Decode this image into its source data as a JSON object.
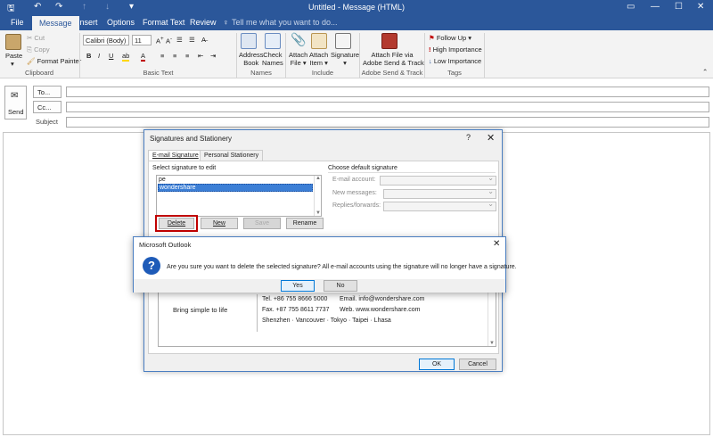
{
  "window": {
    "title": "Untitled - Message (HTML)"
  },
  "tabs": [
    "File",
    "Message",
    "Insert",
    "Options",
    "Format Text",
    "Review"
  ],
  "tell_me": "Tell me what you want to do...",
  "ribbon": {
    "clipboard": {
      "paste": "Paste",
      "cut": "Cut",
      "copy": "Copy",
      "format_painter": "Format Painter",
      "label": "Clipboard"
    },
    "basic_text": {
      "font": "Calibri (Body)",
      "size": "11",
      "label": "Basic Text"
    },
    "names": {
      "address_book": [
        "Address",
        "Book"
      ],
      "check_names": [
        "Check",
        "Names"
      ],
      "label": "Names"
    },
    "include": {
      "attach_file": [
        "Attach",
        "File"
      ],
      "attach_item": [
        "Attach",
        "Item"
      ],
      "signature": "Signature",
      "label": "Include"
    },
    "adobe": {
      "attach": [
        "Attach File via",
        "Adobe Send & Track"
      ],
      "label": "Adobe Send & Track"
    },
    "tags": {
      "follow_up": "Follow Up",
      "high": "High Importance",
      "low": "Low Importance",
      "label": "Tags"
    }
  },
  "compose": {
    "send": "Send",
    "to": "To...",
    "cc": "Cc...",
    "subject": "Subject"
  },
  "signatures_dialog": {
    "title": "Signatures and Stationery",
    "help": "?",
    "tabs": [
      "E-mail Signature",
      "Personal Stationery"
    ],
    "select_label": "Select signature to edit",
    "signatures": [
      "pe",
      "wondershare"
    ],
    "selected": "wondershare",
    "buttons": {
      "delete": "Delete",
      "new": "New",
      "save": "Save",
      "rename": "Rename"
    },
    "defaults_label": "Choose default signature",
    "email_account": "E-mail account:",
    "new_messages": "New messages:",
    "replies": "Replies/forwards:",
    "preview": {
      "tagline": "Bring simple to life",
      "tel": "Tel. +86 755 8666 5000",
      "fax": "Fax. +87 755 8611 7737",
      "email": "Email. info@wondershare.com",
      "web": "Web. www.wondershare.com",
      "cities": "Shenzhen · Vancouver · Tokyo · Taipei · Lhasa"
    },
    "ok": "OK",
    "cancel": "Cancel"
  },
  "confirm_dialog": {
    "title": "Microsoft Outlook",
    "message": "Are you sure you want to delete the selected signature? All e-mail accounts using the signature will no longer have a signature.",
    "yes": "Yes",
    "no": "No"
  },
  "colors": {
    "accent": "#2b579a",
    "selection": "#3c7fd6",
    "highlight_border": "#c00000"
  }
}
